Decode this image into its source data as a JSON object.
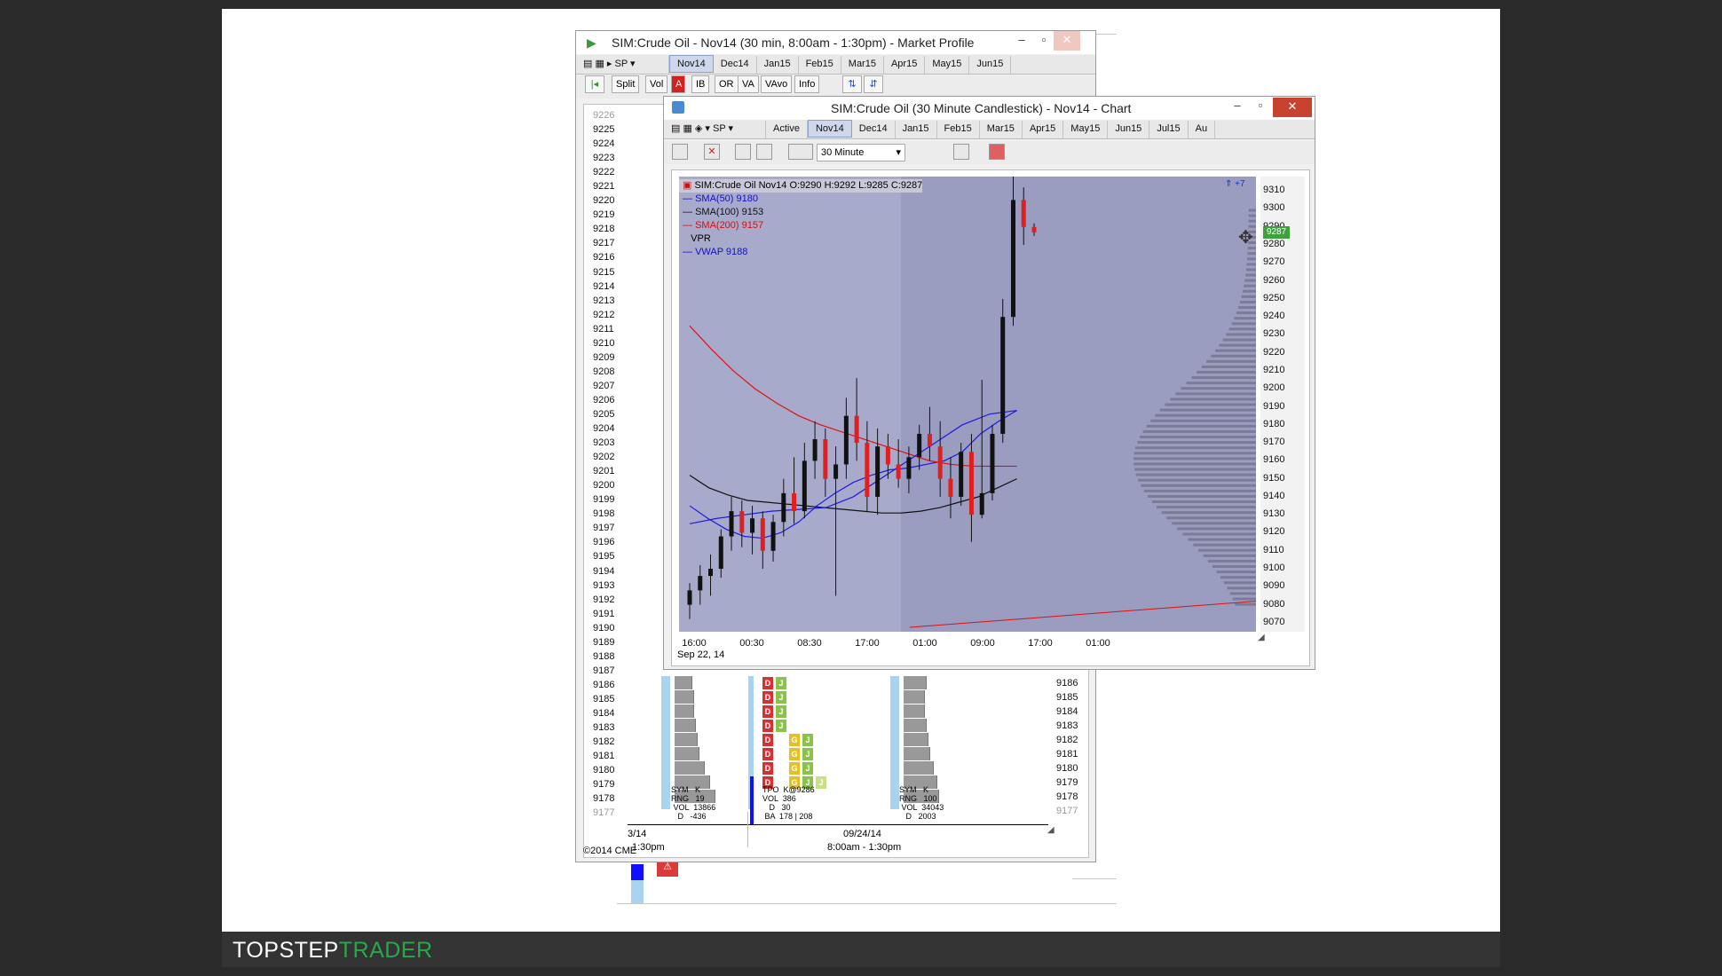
{
  "brand": {
    "part1": "TOPSTEP",
    "part2": "TRADER"
  },
  "mp_window": {
    "title": "SIM:Crude Oil - Nov14 (30 min, 8:00am - 1:30pm) - Market Profile",
    "tabs": [
      "Nov14",
      "Dec14",
      "Jan15",
      "Feb15",
      "Mar15",
      "Apr15",
      "May15",
      "Jun15"
    ],
    "selected_tab": "Nov14",
    "symbol_btn": "SP",
    "toolbar": [
      "Split",
      "Vol",
      "A",
      "IB",
      "OR",
      "VA",
      "VAvo",
      "Info"
    ],
    "prices": [
      "9226",
      "9225",
      "9224",
      "9223",
      "9222",
      "9221",
      "9220",
      "9219",
      "9218",
      "9217",
      "9216",
      "9215",
      "9214",
      "9213",
      "9212",
      "9211",
      "9210",
      "9209",
      "9208",
      "9207",
      "9206",
      "9205",
      "9204",
      "9203",
      "9202",
      "9201",
      "9200",
      "9199",
      "9198",
      "9197",
      "9196",
      "9195",
      "9194",
      "9193",
      "9192",
      "9191",
      "9190",
      "9189",
      "9188",
      "9187",
      "9186",
      "9185",
      "9184",
      "9183",
      "9182",
      "9181",
      "9180",
      "9179",
      "9178",
      "9177"
    ],
    "prices_right": [
      "9186",
      "9185",
      "9184",
      "9183",
      "9182",
      "9181",
      "9180",
      "9179",
      "9178",
      "9177"
    ],
    "stats_left": {
      "sym": "SYM",
      "sym_v": "K",
      "rng": "RNG",
      "rng_v": "19",
      "vol": "VOL",
      "vol_v": "13866",
      "d": "D",
      "d_v": "-436"
    },
    "stats_mid": {
      "tpo": "TPO",
      "tpo_v": "K@9286",
      "vol": "VOL",
      "vol_v": "386",
      "d": "D",
      "d_v": "30",
      "ba": "BA",
      "ba_v": "178 | 208"
    },
    "stats_right": {
      "sym": "SYM",
      "sym_v": "K",
      "rng": "RNG",
      "rng_v": "100",
      "vol": "VOL",
      "vol_v": "34043",
      "d": "D",
      "d_v": "2003"
    },
    "letters": [
      "D",
      "J",
      "D",
      "J",
      "D",
      "J",
      "D",
      "J",
      "D",
      "G",
      "J",
      "D",
      "G",
      "J",
      "D",
      "G",
      "J"
    ],
    "date_left": "3/14",
    "time_left": "1:30pm",
    "date_mid": "09/24/14",
    "time_mid": "8:00am - 1:30pm",
    "copyright": "©2014 CME"
  },
  "chart_window": {
    "title": "SIM:Crude Oil (30 Minute Candlestick) - Nov14 - Chart",
    "symbol_btn": "SP",
    "tabs": [
      "Active",
      "Nov14",
      "Dec14",
      "Jan15",
      "Feb15",
      "Mar15",
      "Apr15",
      "May15",
      "Jun15",
      "Jul15",
      "Au"
    ],
    "selected_tab": "Nov14",
    "interval": "30 Minute",
    "legend": {
      "ohlc": "SIM:Crude Oil Nov14 O:9290 H:9292 L:9285 C:9287",
      "sma50": "SMA(50)  9180",
      "sma100": "SMA(100)  9153",
      "sma200": "SMA(200)  9157",
      "vpr": "VPR",
      "vwap": "VWAP  9188"
    },
    "last_price": "9287",
    "badge": "+7"
  },
  "chart_data": {
    "type": "candlestick",
    "title": "SIM:Crude Oil (30 Minute Candlestick) - Nov14 - Chart",
    "y_ticks": [
      "9310",
      "9300",
      "9290",
      "9280",
      "9270",
      "9260",
      "9250",
      "9240",
      "9230",
      "9220",
      "9210",
      "9200",
      "9190",
      "9180",
      "9170",
      "9160",
      "9150",
      "9140",
      "9130",
      "9120",
      "9110",
      "9100",
      "9090",
      "9080",
      "9070"
    ],
    "ylim": [
      9065,
      9318
    ],
    "x_ticks": [
      "16:00",
      "00:30",
      "08:30",
      "17:00",
      "01:00",
      "09:00",
      "17:00",
      "01:00"
    ],
    "x_date": "Sep 22, 14",
    "series": [
      {
        "name": "SMA(50)",
        "color": "#1a1ae6",
        "values": [
          9135,
          9128,
          9122,
          9118,
          9117,
          9120,
          9126,
          9135,
          9142,
          9148,
          9152,
          9155,
          9156,
          9158,
          9160,
          9165,
          9175,
          9182,
          9188
        ]
      },
      {
        "name": "SMA(100)",
        "color": "#111111",
        "values": [
          9152,
          9145,
          9141,
          9138,
          9137,
          9136,
          9135,
          9134,
          9133,
          9132,
          9131,
          9131,
          9132,
          9134,
          9137,
          9140,
          9145,
          9150
        ]
      },
      {
        "name": "SMA(200)",
        "color": "#e01010",
        "values": [
          9235,
          9222,
          9210,
          9200,
          9192,
          9185,
          9180,
          9176,
          9172,
          9168,
          9164,
          9160,
          9158,
          9157,
          9157,
          9157
        ]
      },
      {
        "name": "VWAP",
        "color": "#1a1ae6",
        "values": [
          9125,
          9128,
          9130,
          9132,
          9133,
          9134,
          9140,
          9150,
          9160,
          9170,
          9180,
          9186,
          9188
        ]
      }
    ],
    "candles": [
      {
        "o": 9080,
        "h": 9092,
        "l": 9072,
        "c": 9088
      },
      {
        "o": 9088,
        "h": 9102,
        "l": 9080,
        "c": 9096
      },
      {
        "o": 9096,
        "h": 9108,
        "l": 9085,
        "c": 9100
      },
      {
        "o": 9100,
        "h": 9122,
        "l": 9095,
        "c": 9118
      },
      {
        "o": 9118,
        "h": 9140,
        "l": 9110,
        "c": 9132
      },
      {
        "o": 9132,
        "h": 9138,
        "l": 9112,
        "c": 9120
      },
      {
        "o": 9120,
        "h": 9135,
        "l": 9108,
        "c": 9128
      },
      {
        "o": 9128,
        "h": 9132,
        "l": 9100,
        "c": 9110
      },
      {
        "o": 9110,
        "h": 9130,
        "l": 9104,
        "c": 9126
      },
      {
        "o": 9126,
        "h": 9150,
        "l": 9118,
        "c": 9142
      },
      {
        "o": 9142,
        "h": 9162,
        "l": 9125,
        "c": 9132
      },
      {
        "o": 9132,
        "h": 9170,
        "l": 9128,
        "c": 9160
      },
      {
        "o": 9160,
        "h": 9182,
        "l": 9150,
        "c": 9172
      },
      {
        "o": 9172,
        "h": 9178,
        "l": 9140,
        "c": 9150
      },
      {
        "o": 9150,
        "h": 9168,
        "l": 9085,
        "c": 9158
      },
      {
        "o": 9158,
        "h": 9195,
        "l": 9150,
        "c": 9185
      },
      {
        "o": 9185,
        "h": 9206,
        "l": 9160,
        "c": 9170
      },
      {
        "o": 9170,
        "h": 9182,
        "l": 9132,
        "c": 9140
      },
      {
        "o": 9140,
        "h": 9178,
        "l": 9130,
        "c": 9168
      },
      {
        "o": 9168,
        "h": 9175,
        "l": 9150,
        "c": 9158
      },
      {
        "o": 9158,
        "h": 9172,
        "l": 9145,
        "c": 9150
      },
      {
        "o": 9150,
        "h": 9168,
        "l": 9142,
        "c": 9162
      },
      {
        "o": 9162,
        "h": 9180,
        "l": 9155,
        "c": 9175
      },
      {
        "o": 9175,
        "h": 9190,
        "l": 9160,
        "c": 9168
      },
      {
        "o": 9168,
        "h": 9182,
        "l": 9140,
        "c": 9150
      },
      {
        "o": 9150,
        "h": 9162,
        "l": 9128,
        "c": 9140
      },
      {
        "o": 9140,
        "h": 9170,
        "l": 9135,
        "c": 9165
      },
      {
        "o": 9165,
        "h": 9175,
        "l": 9115,
        "c": 9130
      },
      {
        "o": 9130,
        "h": 9205,
        "l": 9128,
        "c": 9142
      },
      {
        "o": 9142,
        "h": 9180,
        "l": 9138,
        "c": 9175
      },
      {
        "o": 9175,
        "h": 9250,
        "l": 9170,
        "c": 9240
      },
      {
        "o": 9240,
        "h": 9318,
        "l": 9235,
        "c": 9305
      },
      {
        "o": 9305,
        "h": 9312,
        "l": 9280,
        "c": 9290
      },
      {
        "o": 9290,
        "h": 9292,
        "l": 9285,
        "c": 9287
      }
    ]
  }
}
